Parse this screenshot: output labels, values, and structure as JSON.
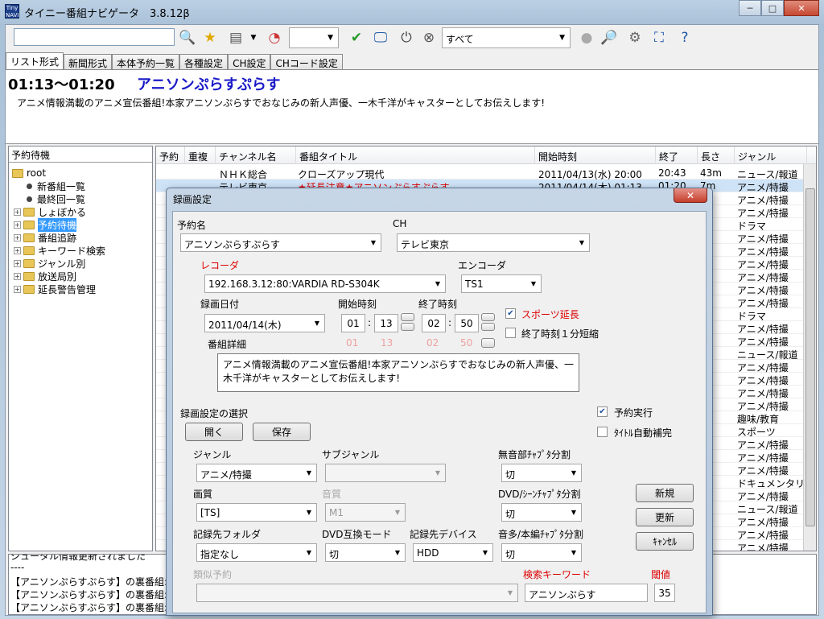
{
  "window": {
    "title": "タイニー番組ナビゲータ　3.8.12β",
    "icon_label": "Tiny NAVI",
    "caption": {
      "min": "─",
      "max": "□",
      "close": "✕"
    }
  },
  "toolbar": {
    "search_value": "",
    "combo_empty": "",
    "filter_value": "すべて"
  },
  "tabs": [
    "リスト形式",
    "新聞形式",
    "本体予約一覧",
    "各種設定",
    "CH設定",
    "CHコード設定"
  ],
  "info": {
    "time": "01:13〜01:20",
    "title": "アニソンぷらすぷらす",
    "desc": "アニメ情報満載のアニメ宣伝番組!本家アニソンぷらすでおなじみの新人声優、一木千洋がキャスターとしてお伝えします!"
  },
  "tree": {
    "header": "予約待機",
    "root": "root",
    "items": [
      "新番組一覧",
      "最終回一覧",
      "しょぼかる",
      "予約待機",
      "番組追跡",
      "キーワード検索",
      "ジャンル別",
      "放送局別",
      "延長警告管理"
    ]
  },
  "list": {
    "columns": [
      "予約",
      "重複",
      "チャンネル名",
      "番組タイトル",
      "開始時刻",
      "終了",
      "長さ",
      "ジャンル"
    ],
    "row1": {
      "channel": "ＮＨＫ総合",
      "title": "クローズアップ現代",
      "start": "2011/04/13(水) 20:00",
      "end": "20:43",
      "len": "43m",
      "genre": "ニュース/報道"
    },
    "row2": {
      "channel": "テレビ東京",
      "title": "★延長注意★アニソンぷらすぷらす",
      "start": "2011/04/14(木) 01:13",
      "end": "01:20",
      "len": "7m",
      "genre": "アニメ/特撮"
    },
    "genres": [
      "アニメ/特撮",
      "アニメ/特撮",
      "ドラマ",
      "アニメ/特撮",
      "アニメ/特撮",
      "アニメ/特撮",
      "アニメ/特撮",
      "アニメ/特撮",
      "アニメ/特撮",
      "ドラマ",
      "アニメ/特撮",
      "アニメ/特撮",
      "ニュース/報道",
      "アニメ/特撮",
      "アニメ/特撮",
      "アニメ/特撮",
      "アニメ/特撮",
      "趣味/教育",
      "スポーツ",
      "アニメ/特撮",
      "アニメ/特撮",
      "アニメ/特撮",
      "ドキュメンタリー...",
      "アニメ/特撮",
      "ニュース/報道",
      "アニメ/特撮",
      "アニメ/特撮",
      "アニメ/特撮"
    ]
  },
  "log": {
    "lines": [
      "シュータル情報更新されました",
      "----",
      "【アニソンぷらすぷらす】の裏番組: シュタイ",
      "【アニソンぷらすぷらす】の裏番組: 明坂聡",
      "【アニソンぷらすぷらす】の裏番組: 聖痕の"
    ]
  },
  "dialog": {
    "title": "録画設定",
    "close": "✕",
    "program_name_label": "予約名",
    "program_name": "アニソンぷらすぷらす",
    "ch_label": "CH",
    "ch": "テレビ東京",
    "recorder_label": "レコーダ",
    "recorder": "192.168.3.12:80:VARDIA RD-S304K",
    "encoder_label": "エンコーダ",
    "encoder": "TS1",
    "date_label": "録画日付",
    "date": "2011/04/14(木)",
    "start_label": "開始時刻",
    "start_h": "01",
    "start_m": "13",
    "end_label": "終了時刻",
    "end_h": "02",
    "end_m": "50",
    "colon": ":",
    "orig_start_h": "01",
    "orig_start_m": "13",
    "orig_end_h": "02",
    "orig_end_m": "50",
    "sports_ext": "スポーツ延長",
    "shorten": "終了時刻１分短縮",
    "detail_label": "番組詳細",
    "detail": "アニメ情報満載のアニメ宣伝番組!本家アニソンぷらすでおなじみの新人声優、一木千洋がキャスターとしてお伝えします!",
    "preset_label": "録画設定の選択",
    "open_btn": "開く",
    "save_btn": "保存",
    "exec_label": "予約実行",
    "auto_title_label": "ﾀｲﾄﾙ自動補完",
    "genre_label": "ジャンル",
    "genre": "アニメ/特撮",
    "subgenre_label": "サブジャンル",
    "subgenre": "",
    "silent_label": "無音部ﾁｬﾌﾟﾀ分割",
    "silent": "切",
    "quality_label": "画質",
    "quality": "[TS]",
    "audio_label": "音質",
    "audio": "M1",
    "dvd_scene_label": "DVD/ｼｰﾝﾁｬﾌﾟﾀ分割",
    "dvd_scene": "切",
    "new_btn": "新規",
    "update_btn": "更新",
    "cancel_btn": "ｷｬﾝｾﾙ",
    "folder_label": "記録先フォルダ",
    "folder": "指定なし",
    "dvd_compat_label": "DVD互換モード",
    "dvd_compat": "切",
    "device_label": "記録先デバイス",
    "device": "HDD",
    "multi_audio_label": "音多/本編ﾁｬﾌﾟﾀ分割",
    "multi_audio": "切",
    "similar_label": "類似予約",
    "similar": "",
    "keyword_label": "検索キーワード",
    "keyword": "アニソンぷらす",
    "threshold_label": "閾値",
    "threshold": "35"
  }
}
